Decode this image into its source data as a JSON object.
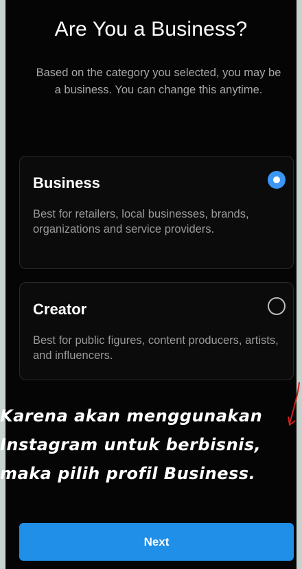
{
  "header": {
    "title": "Are You a Business?",
    "subtitle": "Based on the category you selected, you may be a business. You can change this anytime."
  },
  "options": [
    {
      "title": "Business",
      "description": "Best for retailers, local businesses, brands, organizations and service providers.",
      "selected": true
    },
    {
      "title": "Creator",
      "description": "Best for public figures, content producers, artists, and influencers.",
      "selected": false
    }
  ],
  "annotation": {
    "line1": "Karena akan menggunakan",
    "line2": "Instagram untuk berbisnis,",
    "line3": "maka pilih profil Business.",
    "arrow_color": "#d02020"
  },
  "footer": {
    "next_label": "Next"
  },
  "colors": {
    "accent": "#1f8fe8",
    "radio_selected": "#3b96f4",
    "background": "#050505"
  }
}
